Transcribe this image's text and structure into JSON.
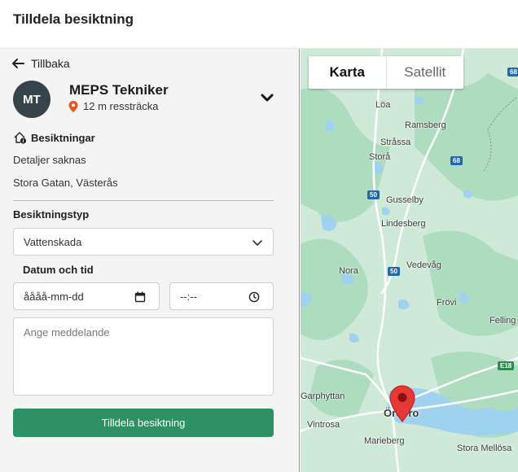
{
  "header": {
    "title": "Tilldela besiktning"
  },
  "nav": {
    "back_label": "Tillbaka"
  },
  "technician": {
    "initials": "MT",
    "name": "MEPS Tekniker",
    "distance": "12 m ressträcka"
  },
  "inspections": {
    "heading": "Besiktningar",
    "details": "Detaljer saknas",
    "address": "Stora Gatan, Västerås"
  },
  "form": {
    "type_label": "Besiktningstyp",
    "type_value": "Vattenskada",
    "datetime_label": "Datum och tid",
    "date_placeholder": "åååå-mm-dd",
    "time_placeholder": "--:--",
    "message_placeholder": "Ange meddelande",
    "submit_label": "Tilldela besiktning"
  },
  "map": {
    "tabs": {
      "map": "Karta",
      "satellite": "Satellit"
    },
    "places": {
      "loa": "Löa",
      "ramsberg": "Ramsberg",
      "strassa": "Stråssa",
      "stora": "Storå",
      "gusselby": "Gusselby",
      "lindesberg": "Lindesberg",
      "nora": "Nora",
      "vedevag": "Vedevåg",
      "frovi": "Frövi",
      "fellingsbro": "Felling",
      "garphyttan": "Garphyttan",
      "orebro": "Örebro",
      "vintrosa": "Vintrosa",
      "marieberg": "Marieberg",
      "storamellosa": "Stora Mellösa"
    },
    "road_numbers": {
      "r68a": "68",
      "r68b": "68",
      "r50a": "50",
      "r50b": "50",
      "e18": "E18"
    },
    "colors": {
      "land": "#cfe9d9",
      "forest": "#aedcbf",
      "water": "#9fd2ee",
      "road": "#ffffff",
      "marker": "#e53935"
    }
  }
}
